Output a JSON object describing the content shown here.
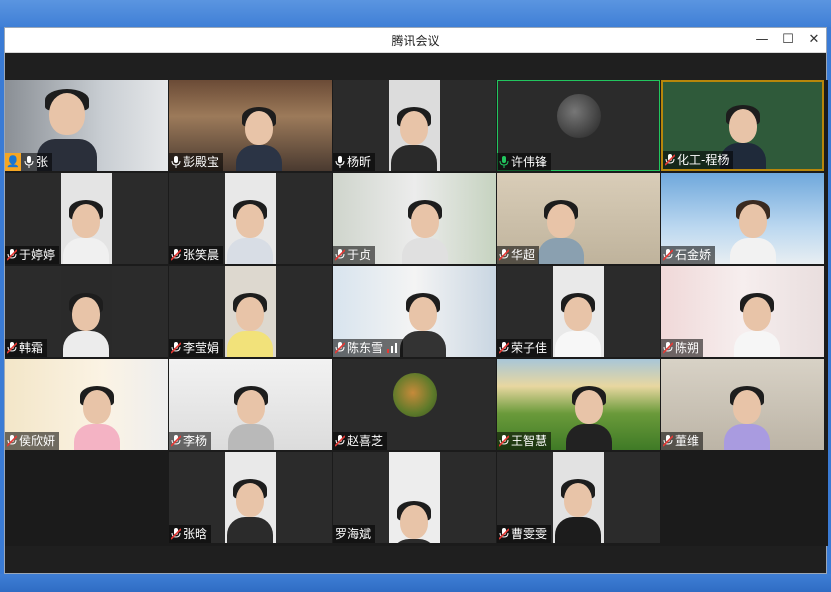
{
  "window": {
    "title": "腾讯会议",
    "controls": {
      "minimize": "—",
      "maximize": "☐",
      "close": "✕"
    }
  },
  "participants": [
    {
      "name": "张",
      "mic": "on",
      "host": true
    },
    {
      "name": "彭殿宝",
      "mic": "on"
    },
    {
      "name": "杨昕",
      "mic": "on"
    },
    {
      "name": "许伟锋",
      "mic": "speaking"
    },
    {
      "name": "化工-程杨",
      "mic": "muted"
    },
    {
      "name": "于婷婷",
      "mic": "muted"
    },
    {
      "name": "张笑晨",
      "mic": "muted"
    },
    {
      "name": "于贞",
      "mic": "muted"
    },
    {
      "name": "华超",
      "mic": "muted"
    },
    {
      "name": "石金娇",
      "mic": "muted"
    },
    {
      "name": "韩霜",
      "mic": "muted"
    },
    {
      "name": "李莹娟",
      "mic": "muted"
    },
    {
      "name": "陈东雪",
      "mic": "muted",
      "signal": true
    },
    {
      "name": "荣子佳",
      "mic": "muted"
    },
    {
      "name": "陈朔",
      "mic": "muted"
    },
    {
      "name": "侯欣妍",
      "mic": "muted"
    },
    {
      "name": "李杨",
      "mic": "muted"
    },
    {
      "name": "赵喜芝",
      "mic": "muted"
    },
    {
      "name": "王智慧",
      "mic": "muted"
    },
    {
      "name": "董维",
      "mic": "muted"
    },
    {
      "name": "张晗",
      "mic": "muted"
    },
    {
      "name": "罗海斌",
      "mic": "none"
    },
    {
      "name": "曹雯雯",
      "mic": "muted"
    }
  ],
  "colors": {
    "speaking": "#22c55e",
    "muted": "#e53935",
    "host_badge": "#f5a623",
    "desktop": "#3f7fd6"
  }
}
